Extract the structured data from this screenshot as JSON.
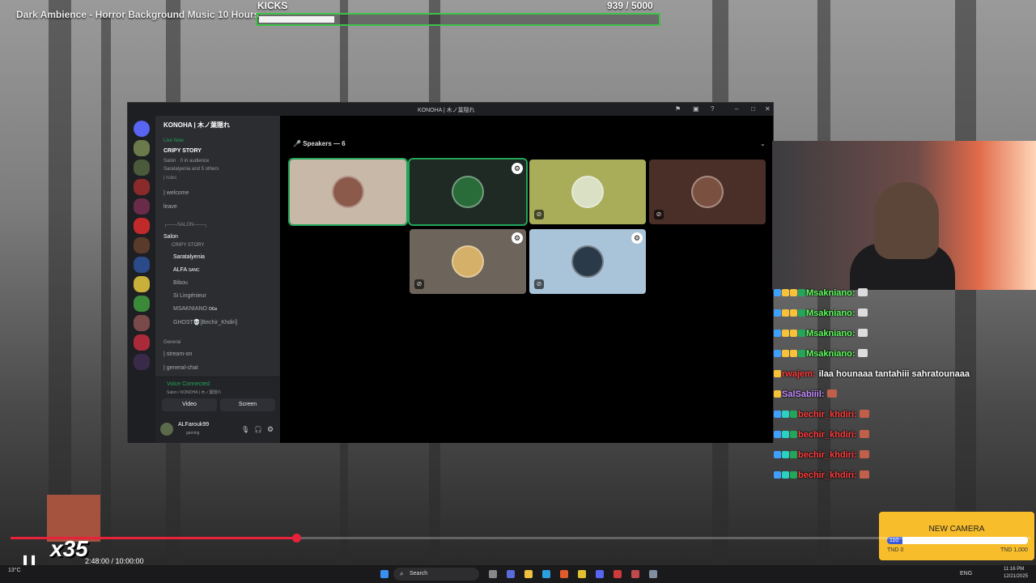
{
  "video_title": "Dark Ambience - Horror Background Music 10 Hours",
  "kicks": {
    "label": "KICKS",
    "count_text": "939  / 5000",
    "current": 939,
    "goal": 5000
  },
  "discord": {
    "window_title": "KONOHA | 木ノ葉隠れ",
    "server_name": "KONOHA | 木ノ葉隠れ",
    "live": {
      "badge": "Live Now",
      "title": "CRIPY STORY",
      "meta": "Salon · 0 in audience",
      "viewers": "Saratalyenia and 5 others"
    },
    "channels": {
      "rules_partial": "| rules",
      "welcome": "| welcome",
      "leave": "leave",
      "salon_category": "┌───SALON───┐",
      "salon": "Salon",
      "salon_sub": "CRIPY STORY",
      "members": [
        {
          "name": "Saratalyenia",
          "tag": ""
        },
        {
          "name": "ALFA",
          "tag": "SANC"
        },
        {
          "name": "Bibou",
          "tag": ""
        },
        {
          "name": "Si Lingénieur",
          "tag": ""
        },
        {
          "name": "MSAKNIANO",
          "tag": "OGs"
        },
        {
          "name": "GHOST💀[Bechir_Khdiri]",
          "tag": ""
        }
      ],
      "general_category": "General",
      "stream_on": "| stream-on",
      "general_chat": "| general-chat"
    },
    "voice": {
      "status": "Voice Connected",
      "location": "Salon / KONOHA | 木ノ葉隠れ",
      "video_label": "Video",
      "screen_label": "Screen"
    },
    "user": {
      "name": "ALFarouk99",
      "status": "gaming"
    },
    "speakers_label": "Speakers — 6",
    "tiles": [
      {
        "bg": "#c8b8a8",
        "border": "#23a55a",
        "avatar": "#8b5a4a",
        "muted": false,
        "option": false
      },
      {
        "bg": "#1f2a24",
        "border": "#23a55a",
        "avatar": "#2a6b3a",
        "muted": false,
        "option": true
      },
      {
        "bg": "#a9ad5a",
        "border": "none",
        "avatar": "#d9e0c4",
        "muted": true,
        "option": false
      },
      {
        "bg": "#4a2f28",
        "border": "none",
        "avatar": "#7a5040",
        "muted": true,
        "option": false
      },
      {
        "bg": "#6d645c",
        "border": "none",
        "avatar": "#d4b068",
        "muted": true,
        "option": true
      },
      {
        "bg": "#a9c3d8",
        "border": "none",
        "avatar": "#2a3a48",
        "muted": true,
        "option": true
      }
    ]
  },
  "chat": [
    {
      "user": "Msakniano:",
      "color": "#5cff5c",
      "text": "",
      "badges": [
        "#3fa0ff",
        "#f7c23a",
        "#f7c23a",
        "#23a55a"
      ],
      "emote": "#dcdcdc"
    },
    {
      "user": "Msakniano:",
      "color": "#5cff5c",
      "text": "",
      "badges": [
        "#3fa0ff",
        "#f7c23a",
        "#f7c23a",
        "#23a55a"
      ],
      "emote": "#dcdcdc"
    },
    {
      "user": "Msakniano:",
      "color": "#5cff5c",
      "text": "",
      "badges": [
        "#3fa0ff",
        "#f7c23a",
        "#f7c23a",
        "#23a55a"
      ],
      "emote": "#dcdcdc"
    },
    {
      "user": "Msakniano:",
      "color": "#5cff5c",
      "text": "",
      "badges": [
        "#3fa0ff",
        "#f7c23a",
        "#f7c23a",
        "#23a55a"
      ],
      "emote": "#dcdcdc"
    },
    {
      "user": "rwajem:",
      "color": "#ff3c3c",
      "text": "ilaa hounaaa tantahiii sahratounaaa",
      "badges": [
        "#f7c23a"
      ],
      "emote": ""
    },
    {
      "user": "SalSabiiil:",
      "color": "#c58cff",
      "text": "",
      "badges": [
        "#f7c23a"
      ],
      "emote": "#c0604a"
    },
    {
      "user": "bechir_khdiri:",
      "color": "#ff3c3c",
      "text": "",
      "badges": [
        "#3fa0ff",
        "#2ad0c0",
        "#23a55a"
      ],
      "emote": "#c0604a"
    },
    {
      "user": "bechir_khdiri:",
      "color": "#ff3c3c",
      "text": "",
      "badges": [
        "#3fa0ff",
        "#2ad0c0",
        "#23a55a"
      ],
      "emote": "#c0604a"
    },
    {
      "user": "bechir_khdiri:",
      "color": "#ff3c3c",
      "text": "",
      "badges": [
        "#3fa0ff",
        "#2ad0c0",
        "#23a55a"
      ],
      "emote": "#c0604a"
    },
    {
      "user": "bechir_khdiri:",
      "color": "#ff3c3c",
      "text": "",
      "badges": [
        "#3fa0ff",
        "#2ad0c0",
        "#23a55a"
      ],
      "emote": "#c0604a"
    }
  ],
  "goal": {
    "title": "NEW CAMERA",
    "value_text": "110",
    "min": "TND 0",
    "max": "TND 1,000",
    "current": 110,
    "target": 1000
  },
  "player": {
    "time": "2:48:00 / 10:00:00",
    "progress": 0.28,
    "multiplier": "x35"
  },
  "taskbar": {
    "search_label": "Search",
    "weather": "13°C",
    "lang": "ENG",
    "clock": "11:16 PM",
    "date": "12/21/2025"
  }
}
